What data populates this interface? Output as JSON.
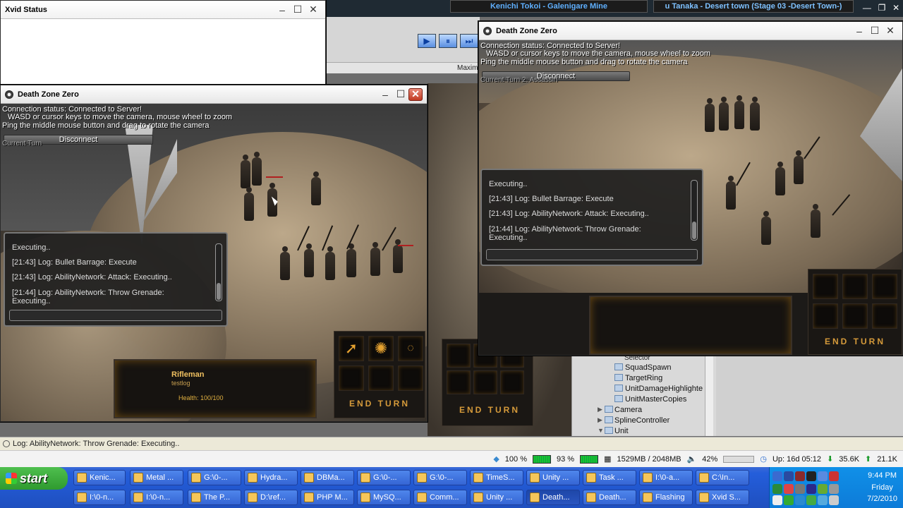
{
  "media_tabs": [
    {
      "label": "Kenichi Tokoi - Galenigare Mine"
    },
    {
      "label": "u Tanaka - Desert town (Stage 03 -Desert Town-)"
    }
  ],
  "xvid": {
    "title": "Xvid Status"
  },
  "editor_strip": {
    "maximize_label": "Maxim"
  },
  "game_left": {
    "title": "Death Zone Zero",
    "status": "Connection status: Connected to Server!",
    "help1": "WASD or cursor keys to move the camera, mouse wheel to zoom",
    "help2": "Ping the middle mouse button and drag to rotate the camera",
    "disconnect": "Disconnect",
    "current_turn": "Current Turn",
    "log": [
      "Executing..",
      "[21:43] Log: Bullet Barrage: Execute",
      "[21:43] Log: AbilityNetwork: Attack: Executing..",
      "[21:44] Log: AbilityNetwork: Throw Grenade:",
      "Executing.."
    ],
    "unit": {
      "name": "Rifleman",
      "sub": "testlog",
      "health": "Health: 100/100"
    },
    "end_turn": "END TURN"
  },
  "game_right": {
    "title": "Death Zone Zero",
    "status": "Connection status: Connected to Server!",
    "help1": "WASD or cursor keys to move the camera, mouse wheel to zoom",
    "help2": "Ping the middle mouse button and drag to rotate the camera",
    "disconnect": "Disconnect",
    "current_turn": "Current Turn 2: Assassin",
    "log": [
      "Executing..",
      "[21:43] Log: Bullet Barrage: Execute",
      "[21:43] Log: AbilityNetwork: Attack: Executing..",
      "[21:44] Log: AbilityNetwork: Throw Grenade:",
      "Executing.."
    ],
    "end_turn": "END TURN"
  },
  "background_end_turn": "END TURN",
  "hierarchy": {
    "items": [
      "Selector",
      "SquadSpawn",
      "TargetRing",
      "UnitDamageHighlighte",
      "UnitMasterCopies",
      "Camera",
      "SplineController",
      "Unit"
    ]
  },
  "statusbar": {
    "text": "Log: AbilityNetwork: Throw Grenade: Executing.."
  },
  "sysbar": {
    "cpu1": "100 %",
    "cpu2": "93 %",
    "mem": "1529MB / 2048MB",
    "vol": "42%",
    "uptime": "Up: 16d 05:12",
    "down": "35.6K",
    "up": "21.1K"
  },
  "taskbar": {
    "start": "start",
    "row1": [
      "Kenic...",
      "Metal ...",
      "G:\\0-...",
      "Hydra...",
      "DBMa...",
      "G:\\0-...",
      "G:\\0-...",
      "TimeS...",
      "Unity ...",
      "Task ...",
      "I:\\0-a...",
      "C:\\In..."
    ],
    "row2": [
      "I:\\0-n...",
      "I:\\0-n...",
      "The P...",
      "D:\\ref...",
      "PHP M...",
      "MySQ...",
      "Comm...",
      "Unity ...",
      "Death...",
      "Death...",
      "Flashing",
      "Xvid S..."
    ],
    "clock_time": "9:44 PM",
    "clock_day": "Friday",
    "clock_date": "7/2/2010"
  }
}
